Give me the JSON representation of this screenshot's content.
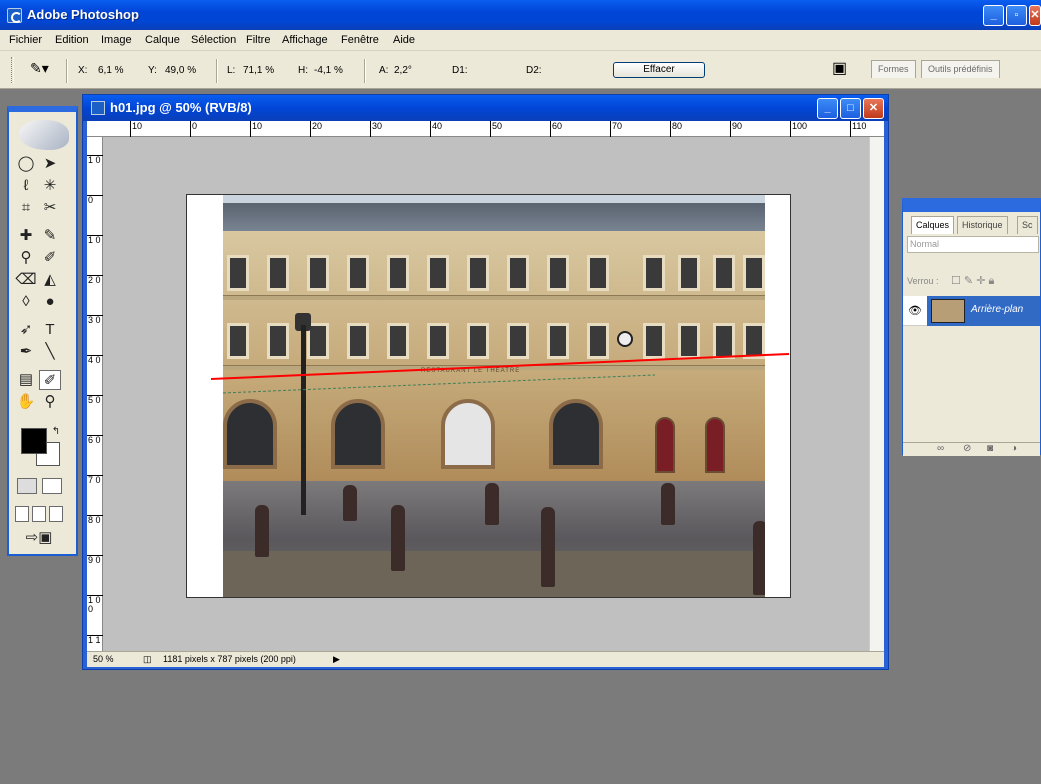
{
  "app": {
    "title": "Adobe Photoshop"
  },
  "menu": [
    "Fichier",
    "Edition",
    "Image",
    "Calque",
    "Sélection",
    "Filtre",
    "Affichage",
    "Fenêtre",
    "Aide"
  ],
  "options": {
    "x_label": "X:",
    "x_value": "6,1 %",
    "y_label": "Y:",
    "y_value": "49,0 %",
    "l_label": "L:",
    "l_value": "71,1 %",
    "h_label": "H:",
    "h_value": "-4,1 %",
    "a_label": "A:",
    "a_value": "2,2°",
    "d1_label": "D1:",
    "d2_label": "D2:",
    "clear_button": "Effacer"
  },
  "palette_well": {
    "tab1": "Formes",
    "tab2": "Outils prédéfinis"
  },
  "document": {
    "title": "h01.jpg @ 50% (RVB/8)",
    "zoom": "50 %",
    "info": "1181 pixels x 787 pixels (200 ppi)",
    "ruler_top": [
      "10",
      "0",
      "10",
      "20",
      "30",
      "40",
      "50",
      "60",
      "70",
      "80",
      "90",
      "100",
      "110"
    ],
    "ruler_left": [
      "1 0",
      "0",
      "1 0",
      "2 0",
      "3 0",
      "4 0",
      "5 0",
      "6 0",
      "7 0",
      "8 0",
      "9 0",
      "1 0 0",
      "1 1"
    ],
    "photo_sign": "RESTAURANT LE THEATRE"
  },
  "layers_panel": {
    "tab_layers": "Calques",
    "tab_history": "Historique",
    "tab_more": "Sc",
    "blend_mode": "Normal",
    "lock_label": "Verrou :",
    "layer_name": "Arrière-plan"
  },
  "colors": {
    "xp_blue": "#0046d5",
    "panel_bg": "#ece9d8",
    "measure_line": "#ff0000",
    "selection": "#316ac5"
  }
}
